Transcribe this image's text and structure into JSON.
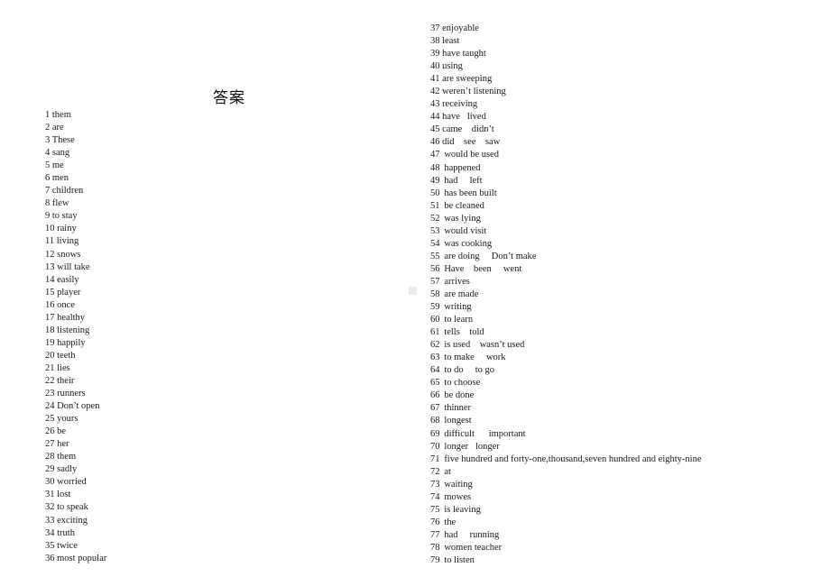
{
  "document": {
    "title": "答案",
    "background_color": "#ffffff",
    "text_color": "#1a1a1a",
    "artifact_color": "#ebebeb"
  },
  "columns": {
    "left": {
      "name": "answers-column-left",
      "start_number": 1,
      "end_number": 36,
      "items": [
        {
          "num": "1",
          "text": "them"
        },
        {
          "num": "2",
          "text": "are"
        },
        {
          "num": "3",
          "text": "These"
        },
        {
          "num": "4",
          "text": "sang"
        },
        {
          "num": "5",
          "text": "me"
        },
        {
          "num": "6",
          "text": "men"
        },
        {
          "num": "7",
          "text": "children"
        },
        {
          "num": "8",
          "text": "flew"
        },
        {
          "num": "9",
          "text": "to stay"
        },
        {
          "num": "10",
          "text": "rainy"
        },
        {
          "num": "11",
          "text": "living"
        },
        {
          "num": "12",
          "text": "snows"
        },
        {
          "num": "13",
          "text": "will take"
        },
        {
          "num": "14",
          "text": "easily"
        },
        {
          "num": "15",
          "text": "player"
        },
        {
          "num": "16",
          "text": "once"
        },
        {
          "num": "17",
          "text": "healthy"
        },
        {
          "num": "18",
          "text": "listening"
        },
        {
          "num": "19",
          "text": "happily"
        },
        {
          "num": "20",
          "text": "teeth"
        },
        {
          "num": "21",
          "text": "lies"
        },
        {
          "num": "22",
          "text": "their"
        },
        {
          "num": "23",
          "text": "runners"
        },
        {
          "num": "24",
          "text": "Don’t open"
        },
        {
          "num": "25",
          "text": "yours"
        },
        {
          "num": "26",
          "text": "be"
        },
        {
          "num": "27",
          "text": "her"
        },
        {
          "num": "28",
          "text": "them"
        },
        {
          "num": "29",
          "text": "sadly"
        },
        {
          "num": "30",
          "text": "worried"
        },
        {
          "num": "31",
          "text": "lost"
        },
        {
          "num": "32",
          "text": "to speak"
        },
        {
          "num": "33",
          "text": "exciting"
        },
        {
          "num": "34",
          "text": "truth"
        },
        {
          "num": "35",
          "text": "twice"
        },
        {
          "num": "36",
          "text": "most popular"
        }
      ]
    },
    "right": {
      "name": "answers-column-right",
      "start_number": 37,
      "end_number": 79,
      "items": [
        {
          "num": "37",
          "text": "enjoyable"
        },
        {
          "num": "38",
          "text": "least"
        },
        {
          "num": "39",
          "text": "have taught"
        },
        {
          "num": "40",
          "text": "using"
        },
        {
          "num": "41",
          "text": "are sweeping"
        },
        {
          "num": "42",
          "text": "weren’t listening"
        },
        {
          "num": "43",
          "text": "receiving"
        },
        {
          "num": "44",
          "text": "have   lived"
        },
        {
          "num": "45",
          "text": "came    didn’t"
        },
        {
          "num": "46",
          "text": "did    see    saw"
        },
        {
          "num": "47",
          "text": "would be used"
        },
        {
          "num": "48",
          "text": "happened"
        },
        {
          "num": "49",
          "text": "had     left"
        },
        {
          "num": "50",
          "text": "has been built"
        },
        {
          "num": "51",
          "text": "be cleaned"
        },
        {
          "num": "52",
          "text": "was lying"
        },
        {
          "num": "53",
          "text": "would visit"
        },
        {
          "num": "54",
          "text": "was cooking"
        },
        {
          "num": "55",
          "text": "are doing     Don’t make"
        },
        {
          "num": "56",
          "text": "Have    been     went"
        },
        {
          "num": "57",
          "text": "arrives"
        },
        {
          "num": "58",
          "text": "are made"
        },
        {
          "num": "59",
          "text": "writing"
        },
        {
          "num": "60",
          "text": "to learn"
        },
        {
          "num": "61",
          "text": "tells    told"
        },
        {
          "num": "62",
          "text": "is used    wasn’t used"
        },
        {
          "num": "63",
          "text": "to make     work"
        },
        {
          "num": "64",
          "text": "to do     to go"
        },
        {
          "num": "65",
          "text": "to choose"
        },
        {
          "num": "66",
          "text": "be done"
        },
        {
          "num": "67",
          "text": "thinner"
        },
        {
          "num": "68",
          "text": "longest"
        },
        {
          "num": "69",
          "text": "difficult      important"
        },
        {
          "num": "70",
          "text": "longer   longer"
        },
        {
          "num": "71",
          "text": "five hundred and forty-one,thousand,seven hundred and eighty-nine"
        },
        {
          "num": "72",
          "text": "at"
        },
        {
          "num": "73",
          "text": "waiting"
        },
        {
          "num": "74",
          "text": "mowes"
        },
        {
          "num": "75",
          "text": "is leaving"
        },
        {
          "num": "76",
          "text": "the"
        },
        {
          "num": "77",
          "text": "had     running"
        },
        {
          "num": "78",
          "text": "women teacher"
        },
        {
          "num": "79",
          "text": "to listen"
        }
      ]
    }
  }
}
